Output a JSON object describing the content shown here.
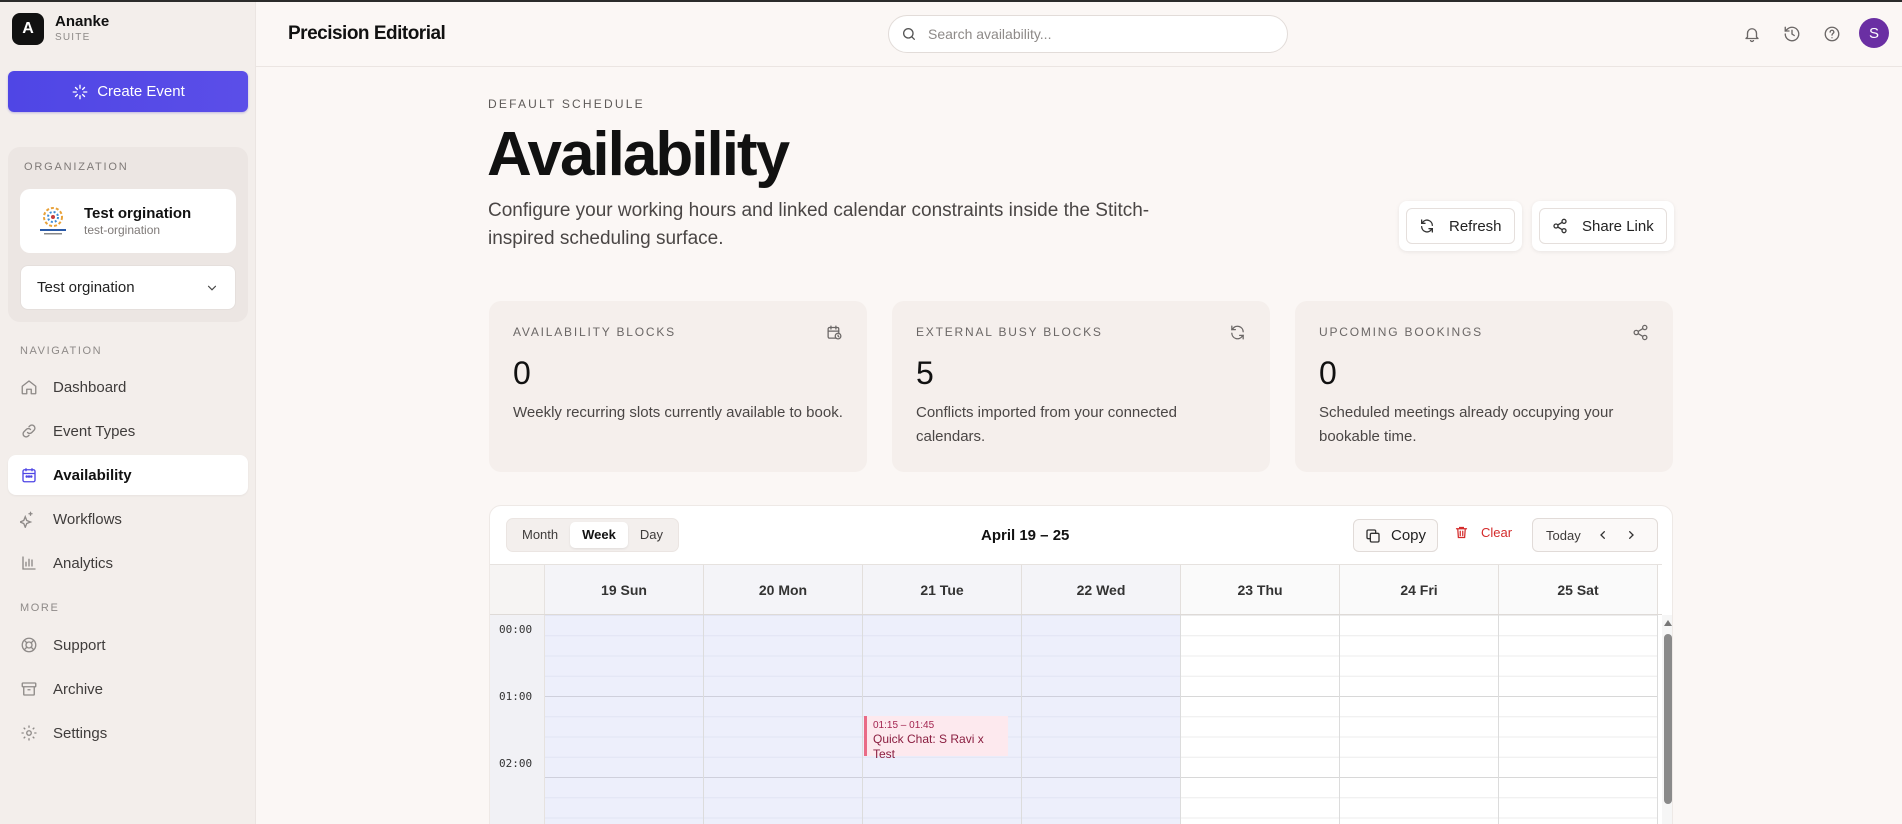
{
  "brand": {
    "logo_letter": "A",
    "name": "Ananke",
    "sub": "SUITE"
  },
  "sidebar": {
    "create_button": "Create Event",
    "org": {
      "section_label": "ORGANIZATION",
      "name": "Test orgination",
      "slug": "test-orgination",
      "select_value": "Test orgination"
    },
    "nav_label": "NAVIGATION",
    "nav_items": [
      {
        "label": "Dashboard",
        "icon": "home-icon"
      },
      {
        "label": "Event Types",
        "icon": "link-icon"
      },
      {
        "label": "Availability",
        "icon": "calendar-icon",
        "active": true
      },
      {
        "label": "Workflows",
        "icon": "sparkle-icon"
      },
      {
        "label": "Analytics",
        "icon": "bar-chart-icon"
      }
    ],
    "more_label": "MORE",
    "more_items": [
      {
        "label": "Support",
        "icon": "lifebuoy-icon"
      },
      {
        "label": "Archive",
        "icon": "archive-icon"
      },
      {
        "label": "Settings",
        "icon": "gear-icon"
      }
    ]
  },
  "topbar": {
    "title": "Precision Editorial",
    "search_placeholder": "Search availability...",
    "avatar_letter": "S",
    "avatar_color": "#6a2fa3"
  },
  "header": {
    "eyebrow": "DEFAULT SCHEDULE",
    "title": "Availability",
    "description": "Configure your working hours and linked calendar constraints inside the Stitch-inspired scheduling surface.",
    "refresh_label": "Refresh",
    "share_label": "Share Link"
  },
  "stats": [
    {
      "label": "AVAILABILITY BLOCKS",
      "value": "0",
      "desc": "Weekly recurring slots currently available to book.",
      "icon": "calendar-check-icon"
    },
    {
      "label": "EXTERNAL BUSY BLOCKS",
      "value": "5",
      "desc": "Conflicts imported from your connected calendars.",
      "icon": "refresh-icon"
    },
    {
      "label": "UPCOMING BOOKINGS",
      "value": "0",
      "desc": "Scheduled meetings already occupying your bookable time.",
      "icon": "share-icon"
    }
  ],
  "calendar": {
    "views": [
      "Month",
      "Week",
      "Day"
    ],
    "active_view": "Week",
    "range": "April 19 – 25",
    "copy_label": "Copy",
    "clear_label": "Clear",
    "today_label": "Today",
    "days": [
      "19 Sun",
      "20 Mon",
      "21 Tue",
      "22 Wed",
      "23 Thu",
      "24 Fri",
      "25 Sat"
    ],
    "times": [
      "00:00",
      "01:00",
      "02:00"
    ],
    "event": {
      "time": "01:15 – 01:45",
      "title": "Quick Chat: S Ravi x Test",
      "day": "21 Tue"
    },
    "accent": "#4f46e5",
    "danger": "#d42b2b"
  }
}
